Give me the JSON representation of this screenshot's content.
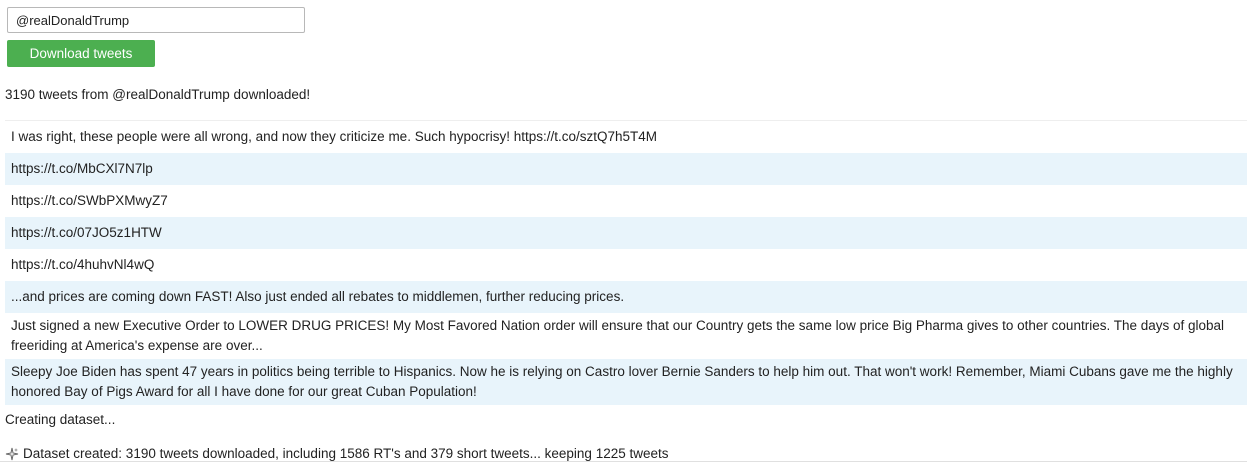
{
  "form": {
    "handle_value": "@realDonaldTrump",
    "download_label": "Download tweets"
  },
  "status": {
    "downloaded": "3190 tweets from @realDonaldTrump downloaded!",
    "creating": "Creating dataset...",
    "created": "Dataset created: 3190 tweets downloaded, including 1586 RT's and 379 short tweets... keeping 1225 tweets",
    "created_icon": "sparkle-icon"
  },
  "tweets": [
    "I was right, these people were all wrong, and now they criticize me. Such hypocrisy! https://t.co/sztQ7h5T4M",
    "https://t.co/MbCXl7N7lp",
    "https://t.co/SWbPXMwyZ7",
    "https://t.co/07JO5z1HTW",
    "https://t.co/4huhvNl4wQ",
    "...and prices are coming down FAST! Also just ended all rebates to middlemen, further reducing prices.",
    "Just signed a new Executive Order to LOWER DRUG PRICES! My Most Favored Nation order will ensure that our Country gets the same low price Big Pharma gives to other countries. The days of global freeriding at America's expense are over...",
    "Sleepy Joe Biden has spent 47 years in politics being terrible to Hispanics. Now he is relying on Castro lover Bernie Sanders to help him out. That won't work! Remember, Miami Cubans gave me the highly honored Bay of Pigs Award for all I have done for our great Cuban Population!"
  ],
  "colors": {
    "button_green": "#4caf50",
    "row_stripe": "#e8f4fb"
  }
}
